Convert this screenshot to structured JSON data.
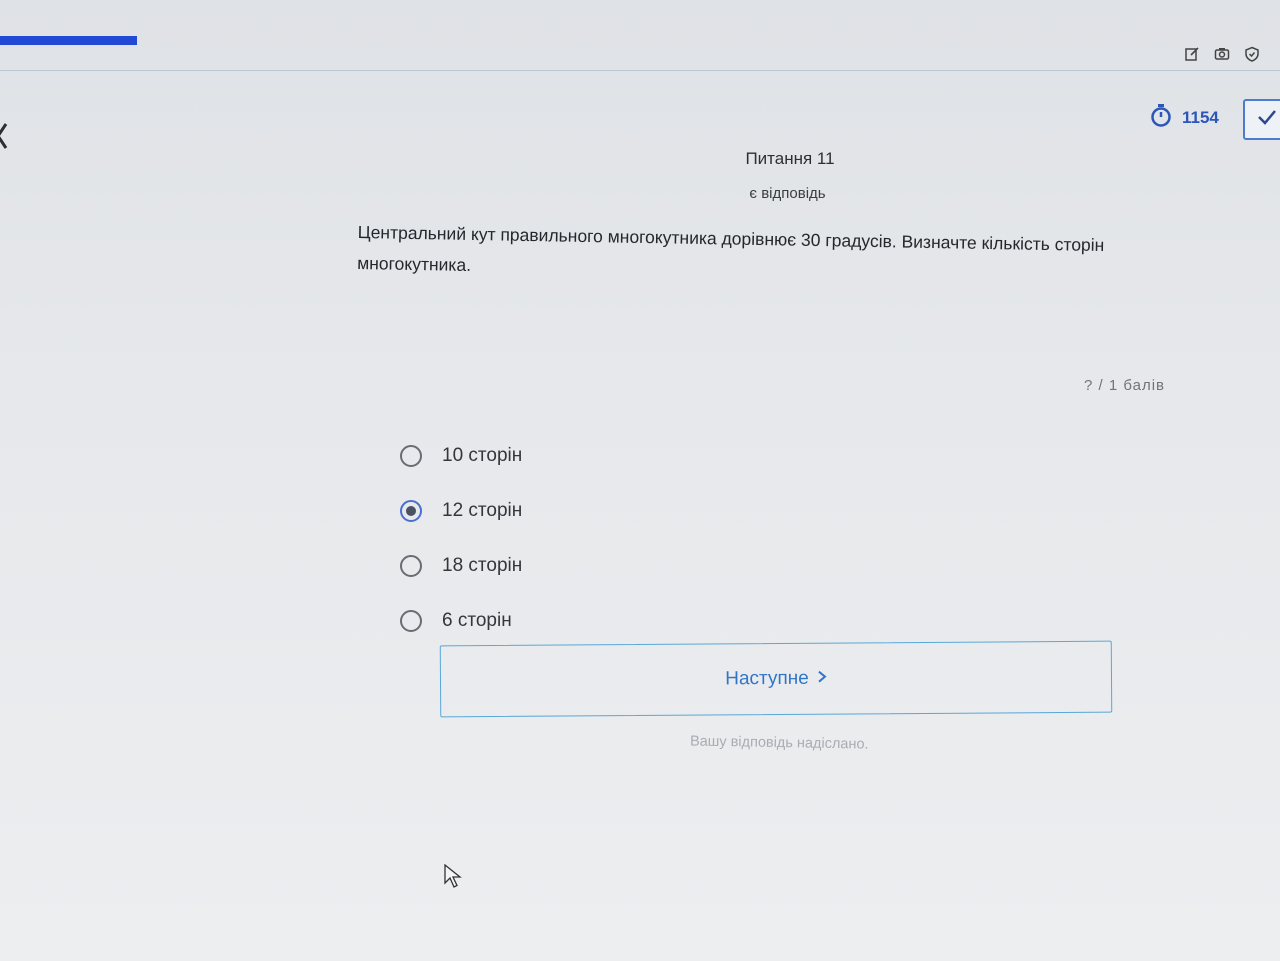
{
  "header": {
    "timer_value": "1154",
    "icons": [
      "edit-icon",
      "camera-icon",
      "shield-icon"
    ]
  },
  "question": {
    "title": "Питання 11",
    "status": "є відповідь",
    "text": "Центральний кут правильного многокутника дорівнює 30 градусів. Визначте кількість сторін многокутника.",
    "score": "? / 1 балів"
  },
  "options": [
    {
      "label": "10 сторін",
      "selected": false
    },
    {
      "label": "12 сторін",
      "selected": true
    },
    {
      "label": "18 сторін",
      "selected": false
    },
    {
      "label": "6 сторін",
      "selected": false
    }
  ],
  "actions": {
    "next_label": "Наступне",
    "submitted_message": "Вашу відповідь надіслано."
  },
  "colors": {
    "accent": "#2149d6",
    "link": "#3076c6",
    "border": "#5aa7d8"
  }
}
